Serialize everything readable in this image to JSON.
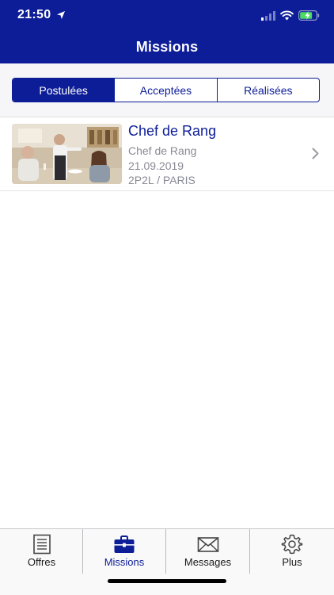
{
  "status_bar": {
    "time": "21:50"
  },
  "header": {
    "title": "Missions"
  },
  "segments": [
    {
      "label": "Postulées",
      "active": true
    },
    {
      "label": "Acceptées",
      "active": false
    },
    {
      "label": "Réalisées",
      "active": false
    }
  ],
  "missions": [
    {
      "title": "Chef de Rang",
      "role": "Chef de Rang",
      "date": "21.09.2019",
      "company": "2P2L / PARIS"
    }
  ],
  "tabs": [
    {
      "label": "Offres",
      "icon": "document-list-icon",
      "active": false
    },
    {
      "label": "Missions",
      "icon": "briefcase-icon",
      "active": true
    },
    {
      "label": "Messages",
      "icon": "envelope-icon",
      "active": false
    },
    {
      "label": "Plus",
      "icon": "gear-icon",
      "active": false
    }
  ],
  "colors": {
    "brand_blue": "#0d1d97",
    "battery_green": "#4cd964",
    "secondary_text": "#8a8a96"
  }
}
